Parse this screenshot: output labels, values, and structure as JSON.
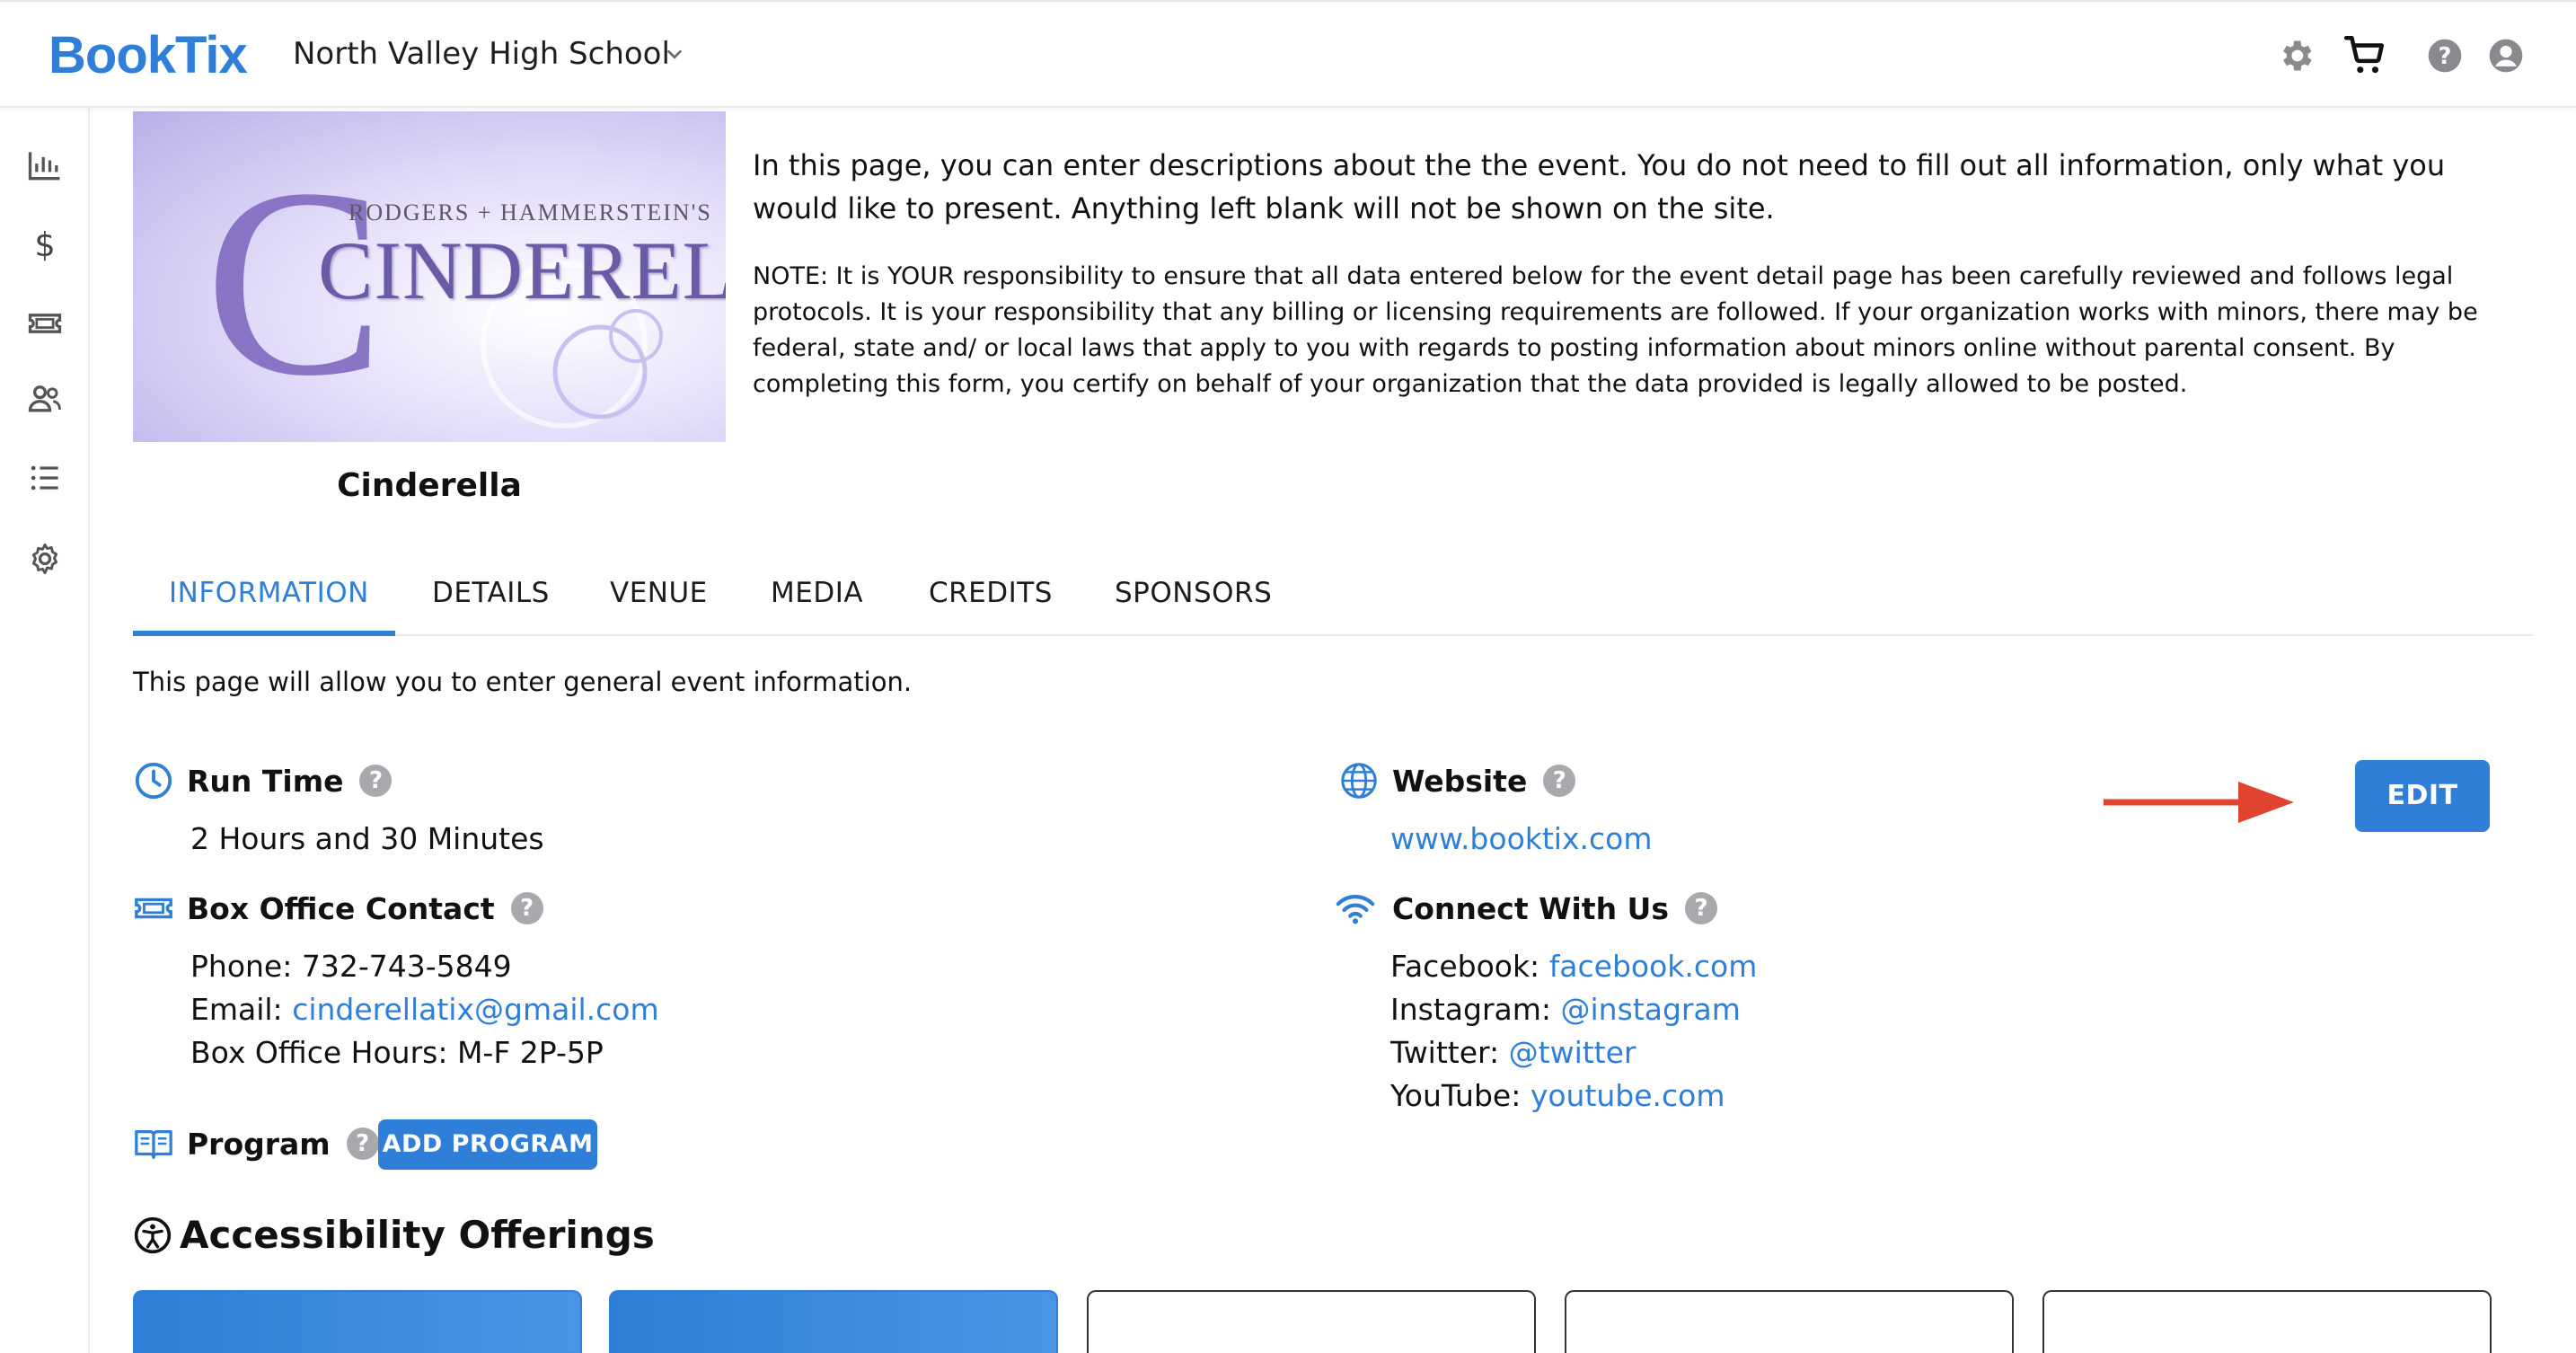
{
  "brand": {
    "logo": "BookTix",
    "accent": "#2f7fd8"
  },
  "header": {
    "org_name": "North Valley High School",
    "icons": [
      "gear-icon",
      "cart-icon",
      "help-icon",
      "account-icon"
    ]
  },
  "sidebar": {
    "icons": [
      "bar-chart-icon",
      "dollar-icon",
      "ticket-icon",
      "users-icon",
      "list-icon",
      "gear-icon"
    ]
  },
  "event": {
    "poster_subtitle": "RODGERS + HAMMERSTEIN'S",
    "poster_title": "CINDERELLA",
    "name": "Cinderella"
  },
  "intro": "In this page, you can enter descriptions about the the event. You do not need to fill out all information, only what you would like to present. Anything left blank will not be shown on the site.",
  "note": "NOTE: It is YOUR responsibility to ensure that all data entered below for the event detail page has been carefully reviewed and follows legal protocols. It is your responsibility that any billing or licensing requirements are followed. If your organization works with minors, there may be federal, state and/ or local laws that apply to you with regards to posting information about minors online without parental consent. By completing this form, you certify on behalf of your organization that the data provided is legally allowed to be posted.",
  "tabs": [
    "INFORMATION",
    "DETAILS",
    "VENUE",
    "MEDIA",
    "CREDITS",
    "SPONSORS"
  ],
  "helper_text": "This page will allow you to enter general event information.",
  "run_time": {
    "label": "Run Time",
    "value": "2 Hours and 30 Minutes"
  },
  "box_office": {
    "label": "Box Office Contact",
    "phone_label": "Phone:",
    "phone": "732-743-5849",
    "email_label": "Email:",
    "email": "cinderellatix@gmail.com",
    "hours_label": "Box Office Hours:",
    "hours": "M-F 2P-5P"
  },
  "program": {
    "label": "Program",
    "button": "ADD PROGRAM"
  },
  "website": {
    "label": "Website",
    "url": "www.booktix.com"
  },
  "connect": {
    "label": "Connect With Us",
    "facebook_label": "Facebook:",
    "facebook": "facebook.com",
    "instagram_label": "Instagram:",
    "instagram": "@instagram",
    "twitter_label": "Twitter:",
    "twitter": "@twitter",
    "youtube_label": "YouTube:",
    "youtube": "youtube.com"
  },
  "edit_button": "EDIT",
  "accessibility": {
    "title": "Accessibility Offerings"
  }
}
